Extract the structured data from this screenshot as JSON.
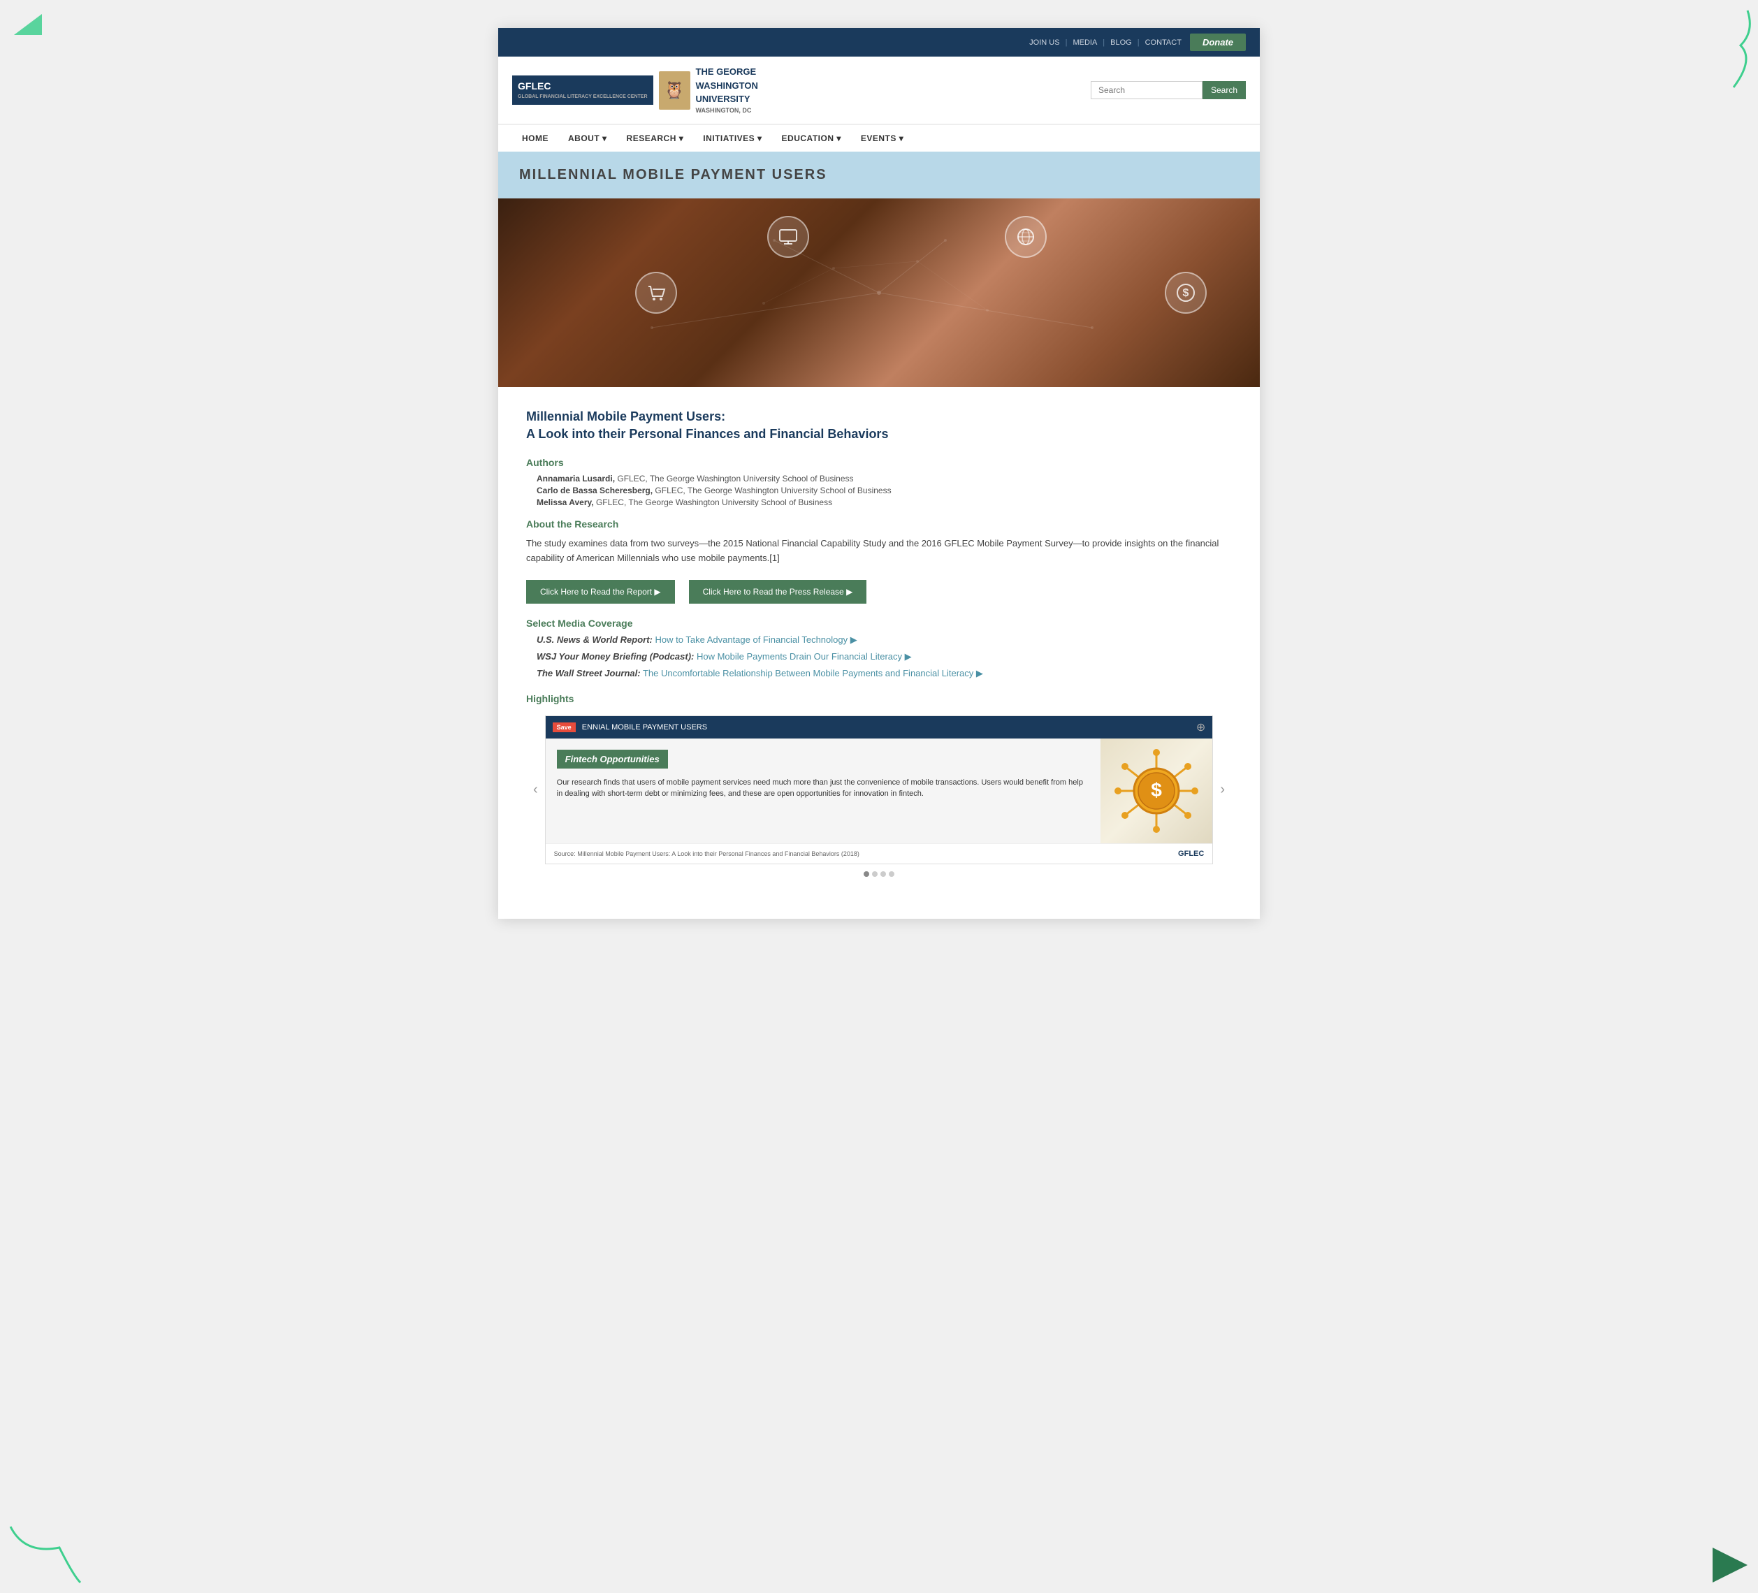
{
  "decorations": {
    "tl_color": "#3ecf8e",
    "tr_color": "#3ecf8e",
    "bl_color": "#3ecf8e",
    "br_color": "#2a7a50"
  },
  "topbar": {
    "links": [
      "JOIN US",
      "MEDIA",
      "BLOG",
      "CONTACT"
    ],
    "donate_label": "Donate"
  },
  "header": {
    "logo_gflec": "GFLEC",
    "logo_sub": "GLOBAL FINANCIAL LITERACY EXCELLENCE CENTER",
    "logo_univ": "THE GEORGE WASHINGTON UNIVERSITY",
    "logo_loc": "WASHINGTON, DC",
    "search_placeholder": "Search",
    "search_btn": "Search"
  },
  "nav": {
    "items": [
      "HOME",
      "ABOUT ▾",
      "RESEARCH ▾",
      "INITIATIVES ▾",
      "EDUCATION ▾",
      "EVENTS ▾"
    ]
  },
  "page_title": "MILLENNIAL MOBILE PAYMENT USERS",
  "article": {
    "title_line1": "Millennial Mobile Payment Users:",
    "title_line2": "A Look into their Personal Finances and Financial Behaviors",
    "authors_label": "Authors",
    "authors": [
      {
        "name": "Annamaria Lusardi,",
        "affil": " GFLEC, The George Washington University School of Business"
      },
      {
        "name": "Carlo de Bassa Scheresberg,",
        "affil": " GFLEC, The George Washington University School of Business"
      },
      {
        "name": "Melissa Avery,",
        "affil": " GFLEC, The George Washington University School of Business"
      }
    ],
    "research_label": "About the Research",
    "research_text": "The study examines data from two surveys—the 2015 National Financial Capability Study and the 2016 GFLEC Mobile Payment Survey—to provide insights on the financial capability of American Millennials who use mobile payments.[1]",
    "read_report_btn": "Click Here to Read the Report ▶",
    "read_press_btn": "Click Here to Read the Press Release ▶",
    "media_label": "Select Media Coverage",
    "media_items": [
      {
        "source": "U.S. News & World Report:",
        "link_text": "How to Take Advantage of Financial Technology ▶",
        "link_url": "#"
      },
      {
        "source": "WSJ Your Money Briefing (Podcast):",
        "link_text": "How Mobile Payments Drain Our Financial Literacy ▶",
        "link_url": "#"
      },
      {
        "source": "The Wall Street Journal:",
        "link_text": "The Uncomfortable Relationship Between Mobile Payments and Financial Literacy ▶",
        "link_url": "#"
      }
    ],
    "highlights_label": "Highlights",
    "card": {
      "top_title": "ENNIAL MOBILE PAYMENT USERS",
      "save_badge": "Save",
      "expand_icon": "⊕",
      "subtitle": "Fintech Opportunities",
      "text": "Our research finds that users of mobile payment services need much more than just the convenience of mobile transactions. Users would benefit from help in dealing with short-term debt or minimizing fees, and these are open opportunities for innovation in fintech.",
      "footer_source": "Source: Millennial Mobile Payment Users: A Look into their Personal Finances and Financial Behaviors (2018)",
      "gflec_logo": "GFLEC"
    },
    "carousel_dots": [
      true,
      false,
      false,
      false
    ]
  }
}
